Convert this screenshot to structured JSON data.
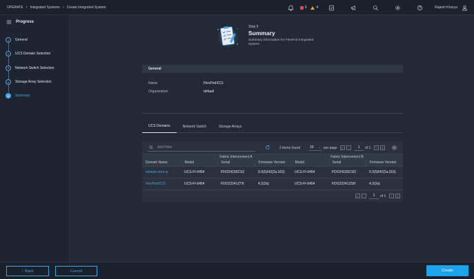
{
  "breadcrumb": {
    "items": [
      "OPERATE",
      "Integrated Systems",
      "Create Integrated System"
    ]
  },
  "topbar": {
    "alerts_red": "3",
    "alerts_yellow": "4",
    "user_name": "Rajesh Kharya",
    "red_color": "#e5484d",
    "yellow_color": "#f5a623"
  },
  "sidebar": {
    "title": "Progress",
    "steps": [
      {
        "num": "1",
        "label": "General"
      },
      {
        "num": "2",
        "label": "UCS Domain Selection"
      },
      {
        "num": "3",
        "label": "Network Switch Selection"
      },
      {
        "num": "4",
        "label": "Storage Array Selection"
      },
      {
        "num": "5",
        "label": "Summary"
      }
    ]
  },
  "header": {
    "step": "Step 5",
    "title": "Summary",
    "subtitle": "Summary information for FlexPod Integrated System"
  },
  "general": {
    "title": "General",
    "name_label": "Name",
    "name_value": "FlexPodXCS",
    "org_label": "Organization",
    "org_value": "default"
  },
  "tabs": [
    "UCS Domains",
    "Network Switch",
    "Storage Arrays"
  ],
  "table": {
    "filter_placeholder": "Add Filter",
    "items_found": "2 items found",
    "per_page_value": "10",
    "per_page_label": "per page",
    "page": "1",
    "page_of": "of 1",
    "group_a": "Fabric Interconnect A",
    "group_b": "Fabric Interconnect B",
    "headers": {
      "domain_name": "Domain Name",
      "model": "Model",
      "serial": "Serial",
      "firmware": "Firmware Version"
    },
    "rows": [
      {
        "domain": "solauto-imm-sj",
        "model_a": "UCS-FI-6454",
        "serial_a": "FDO24150CS2",
        "fw_a": "9.3(5)I42(2a.316)",
        "model_b": "UCS-FI-6454",
        "serial_b": "FDO24150CSD",
        "fw_b": "9.3(5)I42(2a.316)"
      },
      {
        "domain": "FlexPodXCS",
        "model_a": "UCS-FI-6454",
        "serial_a": "FDO22241ZTK",
        "fw_a": "4.2(2a)",
        "model_b": "UCS-FI-6454",
        "serial_b": "FDO22241ZSH",
        "fw_b": "4.2(2a)"
      }
    ]
  },
  "footer": {
    "back": "Back",
    "cancel": "Cancel",
    "create": "Create"
  },
  "accent_color": "#49a3e6"
}
